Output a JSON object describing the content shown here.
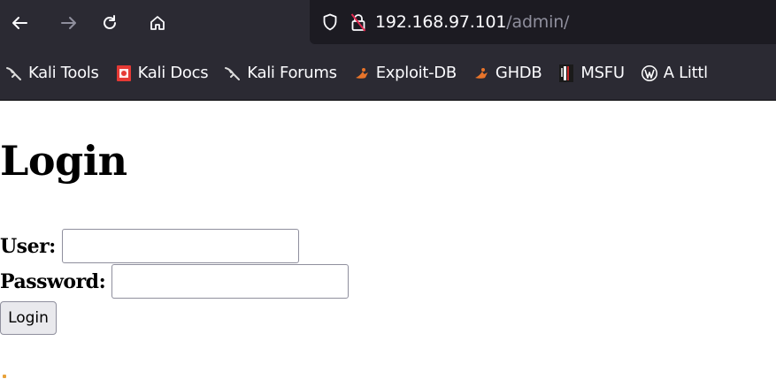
{
  "browser": {
    "url_host": "192.168.97.101",
    "url_path": "/admin/",
    "bookmarks": [
      {
        "label": "Kali Tools",
        "icon": "kali-dragon-icon"
      },
      {
        "label": "Kali Docs",
        "icon": "kali-docs-icon"
      },
      {
        "label": "Kali Forums",
        "icon": "kali-dragon-icon"
      },
      {
        "label": "Exploit-DB",
        "icon": "exploit-db-icon"
      },
      {
        "label": "GHDB",
        "icon": "exploit-db-icon"
      },
      {
        "label": "MSFU",
        "icon": "msfu-icon"
      },
      {
        "label": "A Littl",
        "icon": "wordpress-icon"
      }
    ],
    "colors": {
      "toolbar": "#2b2a33",
      "urlbar": "#1c1b22",
      "lock_warning": "#e22850",
      "exploit_orange": "#e8742a"
    }
  },
  "page": {
    "title": "Login",
    "user_label": "User:",
    "user_value": "",
    "password_label": "Password:",
    "password_value": "",
    "submit_label": "Login"
  }
}
